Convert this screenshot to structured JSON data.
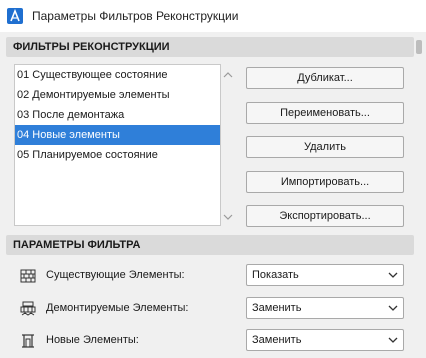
{
  "window": {
    "title": "Параметры Фильтров Реконструкции"
  },
  "filters_section": {
    "header": "ФИЛЬТРЫ РЕКОНСТРУКЦИИ",
    "items": [
      {
        "label": "01 Существующее состояние",
        "selected": false
      },
      {
        "label": "02 Демонтируемые элементы",
        "selected": false
      },
      {
        "label": "03 После демонтажа",
        "selected": false
      },
      {
        "label": "04 Новые элементы",
        "selected": true
      },
      {
        "label": "05 Планируемое состояние",
        "selected": false
      }
    ],
    "buttons": {
      "duplicate": "Дубликат...",
      "rename": "Переименовать...",
      "delete": "Удалить",
      "import": "Импортировать...",
      "export": "Экспортировать..."
    }
  },
  "filter_params_section": {
    "header": "ПАРАМЕТРЫ ФИЛЬТРА",
    "rows": [
      {
        "label": "Существующие Элементы:",
        "value": "Показать",
        "icon": "existing-wall-icon"
      },
      {
        "label": "Демонтируемые Элементы:",
        "value": "Заменить",
        "icon": "demolish-icon"
      },
      {
        "label": "Новые Элементы:",
        "value": "Заменить",
        "icon": "new-element-icon"
      }
    ]
  },
  "colors": {
    "selection": "#2f7fd9",
    "header_bg": "#dadada",
    "window_bg": "#f0f0f0"
  }
}
